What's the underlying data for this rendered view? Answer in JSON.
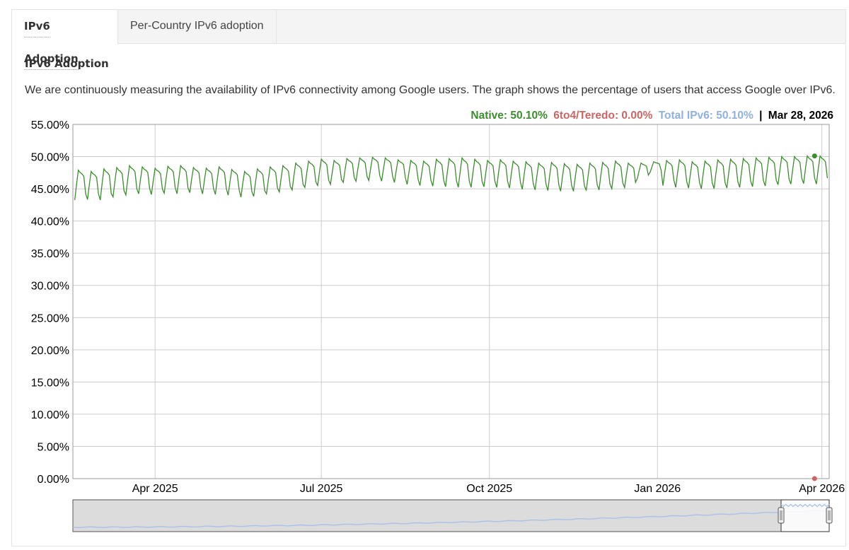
{
  "tabs": [
    {
      "label": "IPv6 Adoption",
      "active": true
    },
    {
      "label": "Per-Country IPv6 adoption",
      "active": false
    }
  ],
  "section": {
    "title": "IPv6 Adoption",
    "description": "We are continuously measuring the availability of IPv6 connectivity among Google users. The graph shows the percentage of users that access Google over IPv6."
  },
  "legend": {
    "native": "Native: 50.10%",
    "teredo": "6to4/Teredo: 0.00%",
    "total": "Total IPv6: 50.10%",
    "separator": "|",
    "date": "Mar 28, 2026"
  },
  "colors": {
    "native": "#3d8c2f",
    "teredo": "#cc6666",
    "total": "#8fb0e0",
    "grid": "#cccccc",
    "navigator_line": "#a9c2e8"
  },
  "chart_data": {
    "type": "line",
    "x_start": "2025-02-15",
    "x_end": "2026-04-05",
    "ylim": [
      0,
      55
    ],
    "y_ticks": [
      "0.00%",
      "5.00%",
      "10.00%",
      "15.00%",
      "20.00%",
      "25.00%",
      "30.00%",
      "35.00%",
      "40.00%",
      "45.00%",
      "50.00%",
      "55.00%"
    ],
    "x_ticks": [
      {
        "label": "Apr 2025",
        "date": "2025-04-01"
      },
      {
        "label": "Jul 2025",
        "date": "2025-07-01"
      },
      {
        "label": "Oct 2025",
        "date": "2025-10-01"
      },
      {
        "label": "Jan 2026",
        "date": "2026-01-01"
      },
      {
        "label": "Apr 2026",
        "date": "2026-04-01"
      }
    ],
    "series": [
      {
        "name": "Native",
        "weekly_low_high": [
          [
            "2025-02-16",
            43.0,
            47.9
          ],
          [
            "2025-02-23",
            43.1,
            47.7
          ],
          [
            "2025-03-02",
            43.0,
            48.1
          ],
          [
            "2025-03-09",
            43.5,
            48.3
          ],
          [
            "2025-03-16",
            43.8,
            48.6
          ],
          [
            "2025-03-23",
            44.0,
            48.4
          ],
          [
            "2025-03-30",
            43.9,
            48.2
          ],
          [
            "2025-04-06",
            44.1,
            48.5
          ],
          [
            "2025-04-13",
            44.0,
            48.6
          ],
          [
            "2025-04-20",
            44.2,
            48.3
          ],
          [
            "2025-04-27",
            44.0,
            48.2
          ],
          [
            "2025-05-04",
            43.9,
            48.4
          ],
          [
            "2025-05-11",
            43.8,
            48.0
          ],
          [
            "2025-05-18",
            43.5,
            47.7
          ],
          [
            "2025-05-25",
            43.6,
            48.1
          ],
          [
            "2025-06-01",
            44.0,
            48.4
          ],
          [
            "2025-06-08",
            44.3,
            48.6
          ],
          [
            "2025-06-15",
            44.6,
            49.0
          ],
          [
            "2025-06-22",
            45.0,
            49.3
          ],
          [
            "2025-06-29",
            45.3,
            49.6
          ],
          [
            "2025-07-06",
            45.5,
            49.4
          ],
          [
            "2025-07-13",
            45.8,
            49.7
          ],
          [
            "2025-07-20",
            46.0,
            49.8
          ],
          [
            "2025-07-27",
            46.1,
            49.9
          ],
          [
            "2025-08-03",
            46.0,
            49.8
          ],
          [
            "2025-08-10",
            45.8,
            49.5
          ],
          [
            "2025-08-17",
            45.5,
            49.4
          ],
          [
            "2025-08-24",
            45.3,
            49.3
          ],
          [
            "2025-08-31",
            45.2,
            49.6
          ],
          [
            "2025-09-07",
            45.1,
            49.7
          ],
          [
            "2025-09-14",
            45.0,
            49.8
          ],
          [
            "2025-09-21",
            45.0,
            49.6
          ],
          [
            "2025-09-28",
            45.1,
            49.4
          ],
          [
            "2025-10-05",
            45.0,
            49.5
          ],
          [
            "2025-10-12",
            44.9,
            49.3
          ],
          [
            "2025-10-19",
            44.7,
            49.2
          ],
          [
            "2025-10-26",
            44.6,
            49.0
          ],
          [
            "2025-11-02",
            44.5,
            49.1
          ],
          [
            "2025-11-09",
            44.4,
            48.9
          ],
          [
            "2025-11-16",
            44.4,
            48.8
          ],
          [
            "2025-11-23",
            44.5,
            49.0
          ],
          [
            "2025-11-30",
            44.6,
            49.1
          ],
          [
            "2025-12-07",
            44.8,
            49.3
          ],
          [
            "2025-12-14",
            45.0,
            49.0
          ],
          [
            "2025-12-21",
            46.5,
            49.0
          ],
          [
            "2025-12-28",
            47.5,
            49.2
          ],
          [
            "2026-01-04",
            45.3,
            49.4
          ],
          [
            "2026-01-11",
            45.0,
            49.5
          ],
          [
            "2026-01-18",
            44.9,
            49.2
          ],
          [
            "2026-01-25",
            44.8,
            49.3
          ],
          [
            "2026-02-01",
            44.8,
            49.5
          ],
          [
            "2026-02-08",
            44.9,
            49.6
          ],
          [
            "2026-02-15",
            45.0,
            49.7
          ],
          [
            "2026-02-22",
            45.1,
            49.8
          ],
          [
            "2026-03-01",
            45.2,
            49.9
          ],
          [
            "2026-03-08",
            45.4,
            50.0
          ],
          [
            "2026-03-15",
            45.5,
            50.0
          ],
          [
            "2026-03-22",
            45.6,
            50.1
          ],
          [
            "2026-03-29",
            45.5,
            50.1
          ]
        ]
      },
      {
        "name": "6to4/Teredo",
        "value": 0.0
      }
    ],
    "highlight": {
      "date": "2026-03-28",
      "native": 50.1,
      "teredo": 0.0
    }
  }
}
